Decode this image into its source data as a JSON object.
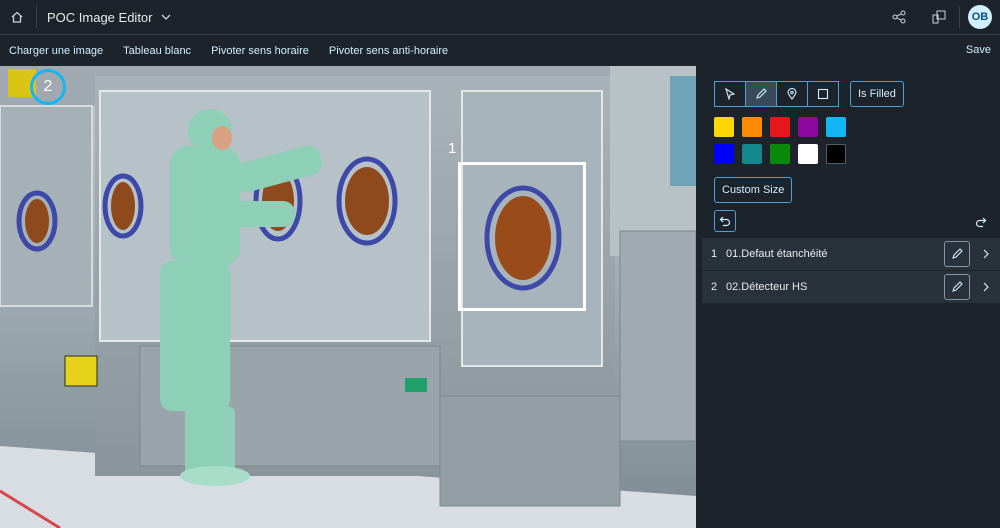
{
  "shell": {
    "app_title": "POC Image Editor",
    "user_initials": "OB"
  },
  "toolbar": {
    "load_image": "Charger une image",
    "whiteboard": "Tableau blanc",
    "rotate_cw": "Pivoter sens horaire",
    "rotate_ccw": "Pivoter sens anti-horaire",
    "save": "Save"
  },
  "canvas": {
    "annotation_1_label": "1",
    "annotation_2_label": "2"
  },
  "panel": {
    "is_filled_label": "Is Filled",
    "custom_size_label": "Custom Size",
    "colors": [
      "#ffd600",
      "#ff8c00",
      "#e5191b",
      "#8e079e",
      "#12b6f5",
      "#0000ff",
      "#13878c",
      "#0a8a0a",
      "#ffffff",
      "#000000"
    ],
    "items": [
      {
        "num": "1",
        "label": "01.Defaut étanchéité"
      },
      {
        "num": "2",
        "label": "02.Détecteur HS"
      }
    ]
  }
}
